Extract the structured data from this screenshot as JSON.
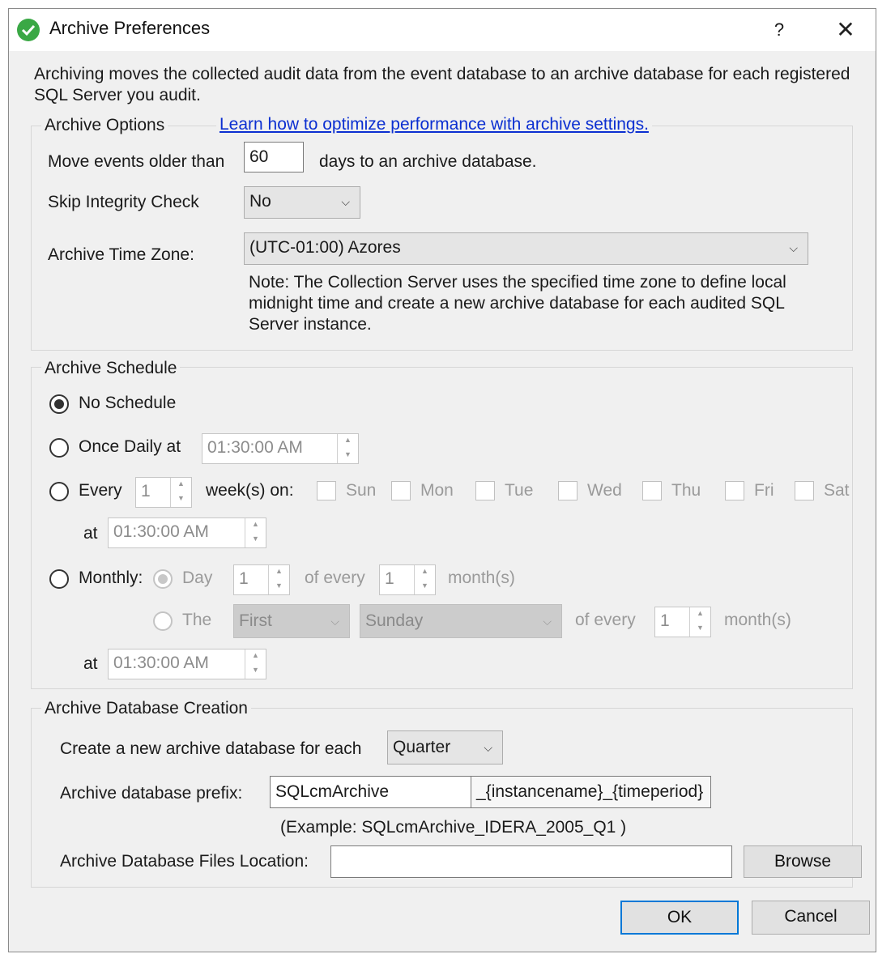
{
  "window": {
    "title": "Archive Preferences",
    "help_label": "?",
    "close_label": "✕"
  },
  "description": "Archiving moves the collected audit data from the event database to an archive database for each registered SQL Server you audit.",
  "archive_options": {
    "legend": "Archive Options",
    "link_text": "Learn how to optimize performance with archive settings.",
    "move_events_label": "Move events older than",
    "move_events_value": "60",
    "move_events_suffix": "days to an archive database.",
    "skip_integrity_label": "Skip Integrity Check",
    "skip_integrity_value": "No",
    "time_zone_label": "Archive Time Zone:",
    "time_zone_value": "(UTC-01:00) Azores",
    "note": "Note: The Collection Server uses the specified time zone to define local midnight time and create a new archive database for each audited SQL Server instance."
  },
  "archive_schedule": {
    "legend": "Archive Schedule",
    "selected": "No Schedule",
    "no_schedule_label": "No Schedule",
    "once_daily_label": "Once Daily at",
    "once_daily_time": "01:30:00 AM",
    "every_label": "Every",
    "every_value": "1",
    "weeks_on_label": "week(s) on:",
    "days": [
      "Sun",
      "Mon",
      "Tue",
      "Wed",
      "Thu",
      "Fri",
      "Sat"
    ],
    "at_label": "at",
    "weekly_time": "01:30:00 AM",
    "monthly_label": "Monthly:",
    "day_label": "Day",
    "day_value": "1",
    "of_every_label": "of every",
    "month_interval_1": "1",
    "months_label": "month(s)",
    "the_label": "The",
    "ordinal_value": "First",
    "weekday_value": "Sunday",
    "month_interval_2": "1",
    "monthly_time": "01:30:00 AM"
  },
  "db_creation": {
    "legend": "Archive Database Creation",
    "create_label": "Create a new archive database for each",
    "period_value": "Quarter",
    "prefix_label": "Archive database prefix:",
    "prefix_value": "SQLcmArchive",
    "prefix_suffix": "_{instancename}_{timeperiod}",
    "example": "(Example: SQLcmArchive_IDERA_2005_Q1 )",
    "location_label": "Archive Database Files Location:",
    "location_value": "",
    "browse_label": "Browse"
  },
  "buttons": {
    "ok": "OK",
    "cancel": "Cancel"
  }
}
